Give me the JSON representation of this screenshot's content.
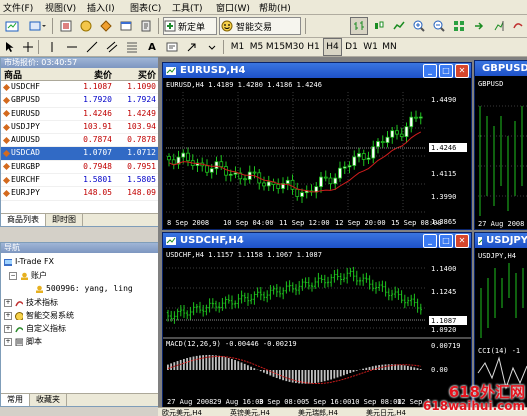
{
  "menu": [
    "文件(F)",
    "视图(V)",
    "插入(I)",
    "图表(C)",
    "工具(T)",
    "窗口(W)",
    "帮助(H)"
  ],
  "toolbar": {
    "new_order": "新定单",
    "expert": "智能交易",
    "timeframes": [
      "M1",
      "M5",
      "M15",
      "M30",
      "H1",
      "H4",
      "D1",
      "W1",
      "MN"
    ],
    "active_timeframe": "H4"
  },
  "market_watch": {
    "title": "市场报价: 03:40:57",
    "col_symbol": "商品",
    "col_bid": "卖价",
    "col_ask": "买价",
    "rows": [
      {
        "symbol": "USDCHF",
        "bid": "1.1087",
        "ask": "1.1090",
        "color": "red"
      },
      {
        "symbol": "GBPUSD",
        "bid": "1.7920",
        "ask": "1.7924",
        "color": "blue"
      },
      {
        "symbol": "EURUSD",
        "bid": "1.4246",
        "ask": "1.4249",
        "color": "red"
      },
      {
        "symbol": "USDJPY",
        "bid": "103.91",
        "ask": "103.94",
        "color": "red"
      },
      {
        "symbol": "AUDUSD",
        "bid": "0.7874",
        "ask": "0.7878",
        "color": "red"
      },
      {
        "symbol": "USDCAD",
        "bid": "1.0707",
        "ask": "1.0712",
        "color": "sel"
      },
      {
        "symbol": "EURGBP",
        "bid": "0.7948",
        "ask": "0.7951",
        "color": "red"
      },
      {
        "symbol": "EURCHF",
        "bid": "1.5801",
        "ask": "1.5805",
        "color": "blue"
      },
      {
        "symbol": "EURJPY",
        "bid": "148.05",
        "ask": "148.09",
        "color": "red"
      }
    ],
    "tabs": [
      "商品列表",
      "即时图"
    ]
  },
  "navigator": {
    "title": "导航",
    "root": "I-Trade FX",
    "accounts": "账户",
    "account": "500996: yang, ling",
    "indicators": "技术指标",
    "experts": "智能交易系统",
    "custom": "自定义指标",
    "scripts": "脚本",
    "tabs": [
      "常用",
      "收藏夹"
    ]
  },
  "charts": {
    "eurusd": {
      "window_title": "EURUSD,H4",
      "header": "EURUSD,H4  1.4189 1.4280 1.4186 1.4246",
      "y_ticks": [
        "1.4490",
        "1.4246",
        "1.4115",
        "1.3990",
        "1.3865"
      ],
      "current": "1.4246",
      "x_ticks": [
        "8 Sep 2008",
        "10 Sep 04:00",
        "11 Sep 12:00",
        "12 Sep 20:00",
        "15 Sep 08:00"
      ]
    },
    "gbpusd": {
      "window_title": "GBPUSD",
      "header": "GBPUSD",
      "x_ticks": [
        "27 Aug 2008"
      ]
    },
    "usdchf": {
      "window_title": "USDCHF,H4",
      "header": "USDCHF,H4  1.1157 1.1158 1.1067 1.1087",
      "y_ticks": [
        "1.1400",
        "1.1245",
        "1.1087",
        "1.0920"
      ],
      "current": "1.1087",
      "macd_header": "MACD(12,26,9) -0.00446 -0.00219",
      "macd_ticks": [
        "0.00719",
        "0.00"
      ],
      "x_ticks": [
        "27 Aug 2008",
        "29 Aug 16:00",
        "3 Sep 08:00",
        "5 Sep 16:00",
        "10 Sep 08:00",
        "12 Sep 1"
      ]
    },
    "usdjpy": {
      "window_title": "USDJPY",
      "header": "USDJPY,H4",
      "cci": "CCI(14) -1"
    }
  },
  "bottom_tabs": [
    "欧元美元,H4",
    "英镑美元,H4",
    "美元瑞郎,H4",
    "美元日元,H4"
  ],
  "watermark": {
    "line1": "618外汇网",
    "line2": "618waihui.com"
  }
}
